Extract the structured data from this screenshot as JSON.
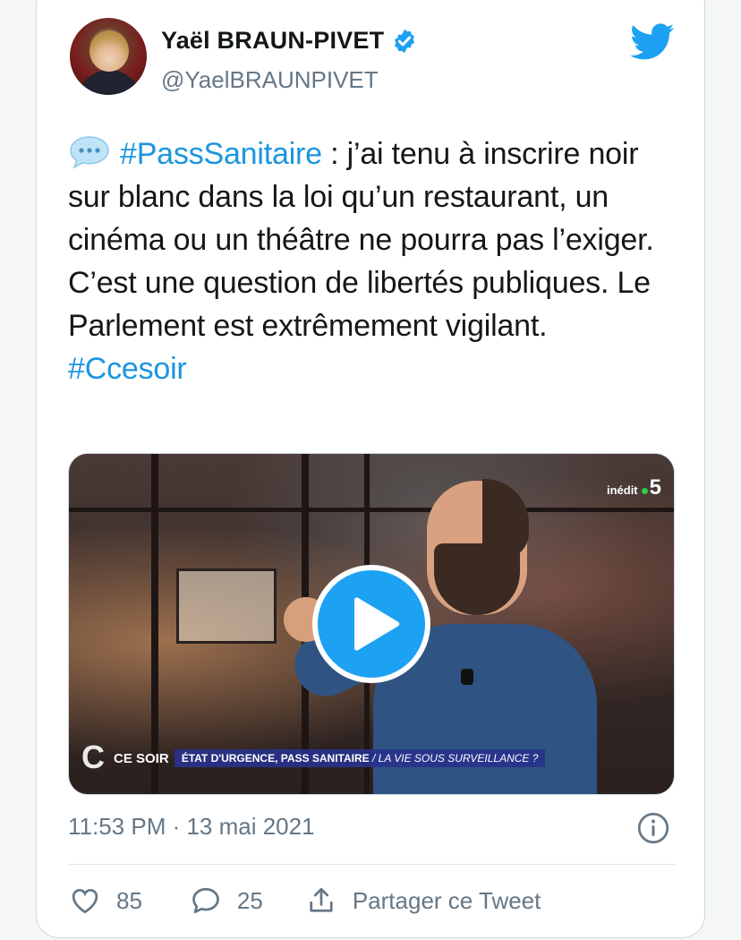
{
  "author": {
    "display_name": "Yaël BRAUN-PIVET",
    "handle": "@YaelBRAUNPIVET",
    "verified": true
  },
  "tweet": {
    "emoji_icon": "speech-balloon-icon",
    "hashtag_1": "#PassSanitaire",
    "body": " : j’ai tenu à inscrire noir sur blanc dans la loi qu’un restaurant, un cinéma ou un théâtre ne pourra pas l’exiger. C’est une question de libertés publiques. Le Parlement est extrêmement vigilant.",
    "hashtag_2": "#Ccesoir"
  },
  "video": {
    "channel_badge": "inédit",
    "channel_number": "5",
    "show_name": "CE SOIR",
    "banner_main": "ÉTAT D'URGENCE, PASS SANITAIRE",
    "banner_sub": "/ LA VIE SOUS SURVEILLANCE ?"
  },
  "meta": {
    "timestamp": "11:53 PM · 13 mai 2021"
  },
  "actions": {
    "likes": "85",
    "replies": "25",
    "share_label": "Partager ce Tweet"
  },
  "colors": {
    "accent": "#1da1f2",
    "hashtag": "#1b95e0",
    "secondary_text": "#657786"
  }
}
